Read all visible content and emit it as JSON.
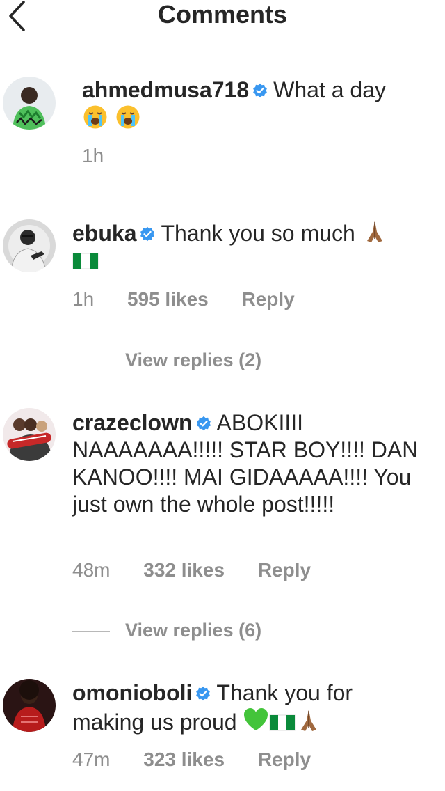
{
  "header": {
    "title": "Comments",
    "back_icon": "chevron-left-icon"
  },
  "caption": {
    "username": "ahmedmusa718",
    "text": "What a day",
    "emojis": [
      "loudly-crying-face",
      "loudly-crying-face"
    ],
    "time": "1h"
  },
  "comments": [
    {
      "username": "ebuka",
      "text": "Thank you so much",
      "emojis_after": [
        "folded-hands",
        "nigeria-flag"
      ],
      "time": "1h",
      "likes": "595 likes",
      "reply_label": "Reply",
      "view_replies": "View replies (2)"
    },
    {
      "username": "crazeclown",
      "text": "ABOKIIII NAAAAAAA!!!!! STAR BOY!!!! DAN KANOO!!!! MAI GIDAAAAA!!!! You just own the whole post!!!!!",
      "time": "48m",
      "likes": "332 likes",
      "reply_label": "Reply",
      "view_replies": "View replies (6)"
    },
    {
      "username": "omonioboli",
      "text": "Thank you for making us proud",
      "emojis_after": [
        "green-heart",
        "nigeria-flag",
        "folded-hands"
      ],
      "time": "47m",
      "likes": "323 likes",
      "reply_label": "Reply"
    }
  ],
  "colors": {
    "text": "#262626",
    "secondary": "#8e8e8e",
    "divider": "#dbdbdb",
    "verified": "#3897f0"
  }
}
